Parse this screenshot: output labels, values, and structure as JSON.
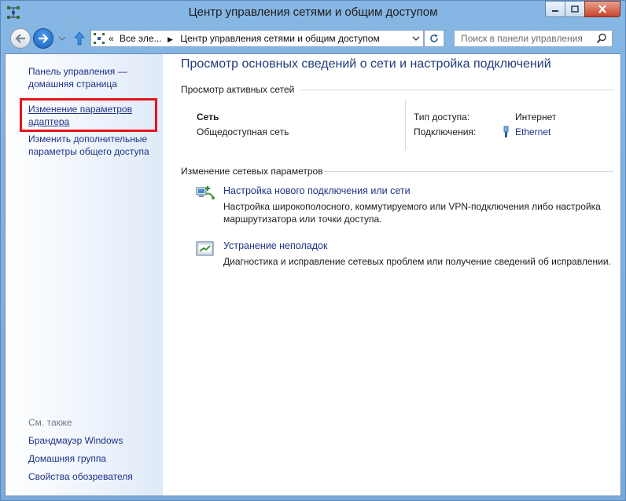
{
  "window": {
    "title": "Центр управления сетями и общим доступом"
  },
  "navbar": {
    "breadcrumb_prefix": "«",
    "breadcrumb_parent": "Все эле...",
    "breadcrumb_sep": "▶",
    "breadcrumb_current": "Центр управления сетями и общим доступом",
    "search_placeholder": "Поиск в панели управления"
  },
  "sidebar": {
    "home_link": "Панель управления — домашняя страница",
    "adapter_link": "Изменение параметров адаптера",
    "sharing_link": "Изменить дополнительные параметры общего доступа",
    "see_also": "См. также",
    "see_also_items": [
      "Брандмауэр Windows",
      "Домашняя группа",
      "Свойства обозревателя"
    ]
  },
  "main": {
    "title": "Просмотр основных сведений о сети и настройка подключений",
    "active_networks": {
      "header": "Просмотр активных сетей",
      "network_name": "Сеть",
      "network_type": "Общедоступная сеть",
      "access_label": "Тип доступа:",
      "access_value": "Интернет",
      "connections_label": "Подключения:",
      "connections_value": "Ethernet"
    },
    "change_settings": {
      "header": "Изменение сетевых параметров",
      "items": [
        {
          "title": "Настройка нового подключения или сети",
          "desc_line1": "Настройка широкополосного, коммутируемого или VPN-подключения либо настройка",
          "desc_line2": "маршрутизатора или точки доступа."
        },
        {
          "title": "Устранение неполадок",
          "desc_line1": "Диагностика и исправление сетевых проблем или получение сведений об исправлении."
        }
      ]
    }
  },
  "colors": {
    "link": "#1e3287",
    "title": "#1e3d7a",
    "highlight": "#e4151b",
    "frame": "#7fb0df"
  }
}
